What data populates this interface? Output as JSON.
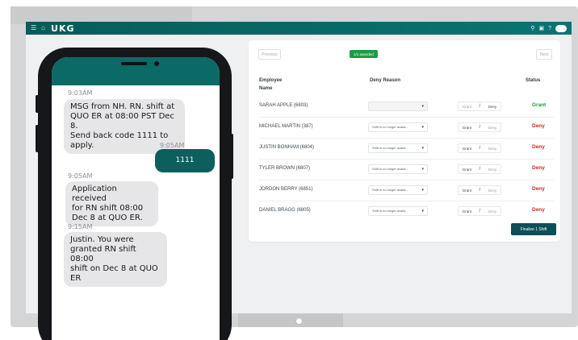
{
  "app": {
    "brand": "UKG",
    "colors": {
      "header": "#0a6b69",
      "grant": "#1e9c44",
      "deny": "#d0281f",
      "finalize": "#0c4f58"
    },
    "header_icons": {
      "left": [
        "menu-icon",
        "home-icon"
      ],
      "right": [
        "search-icon",
        "calendar-icon",
        "help-icon",
        "chat-bubble-icon"
      ]
    }
  },
  "card": {
    "prev_label": "Previous",
    "next_label": "Next",
    "awarded_badge": "1/1 awarded",
    "columns": {
      "employee": "Employee",
      "employee_line2": "Name",
      "reason": "Deny Reason",
      "status": "Status"
    },
    "rows": [
      {
        "name": "SARAH APPLE (6803)",
        "reason": "",
        "grant": "Grant",
        "deny": "Deny",
        "status": "Grant"
      },
      {
        "name": "MICHAEL MARTIN (387)",
        "reason": "Shift is no longer availa...",
        "grant": "Grant",
        "deny": "Deny",
        "status": "Deny"
      },
      {
        "name": "JUSTIN BONHAM (6804)",
        "reason": "Shift is no longer availa...",
        "grant": "Grant",
        "deny": "Deny",
        "status": "Deny"
      },
      {
        "name": "TYLER BROWN (6807)",
        "reason": "Shift is no longer availa...",
        "grant": "Grant",
        "deny": "Deny",
        "status": "Deny"
      },
      {
        "name": "JORDON BERRY (6851)",
        "reason": "Shift is no longer availa...",
        "grant": "Grant",
        "deny": "Deny",
        "status": "Deny"
      },
      {
        "name": "DANIEL BRAGG (6805)",
        "reason": "Shift is no longer availa...",
        "grant": "Grant",
        "deny": "Deny",
        "status": "Deny"
      }
    ],
    "finalize_label": "Finalize 1 Shift"
  },
  "phone": {
    "messages": [
      {
        "time": "9:03AM",
        "direction": "in",
        "text": [
          "MSG from NH. RN. shift at",
          "QUO ER at 08:00 PST Dec 8.",
          "Send back code 1111 to apply."
        ]
      },
      {
        "time": "9:05AM",
        "direction": "out",
        "text": [
          "1111"
        ]
      },
      {
        "time": "9:05AM",
        "direction": "in",
        "text": [
          "Application received",
          "for RN shift 08:00",
          "Dec 8 at QUO ER."
        ]
      },
      {
        "time": "9:15AM",
        "direction": "in",
        "text": [
          "Justin. You were",
          "granted RN shift 08:00",
          "shift on Dec 8 at QUO ER"
        ]
      }
    ]
  }
}
